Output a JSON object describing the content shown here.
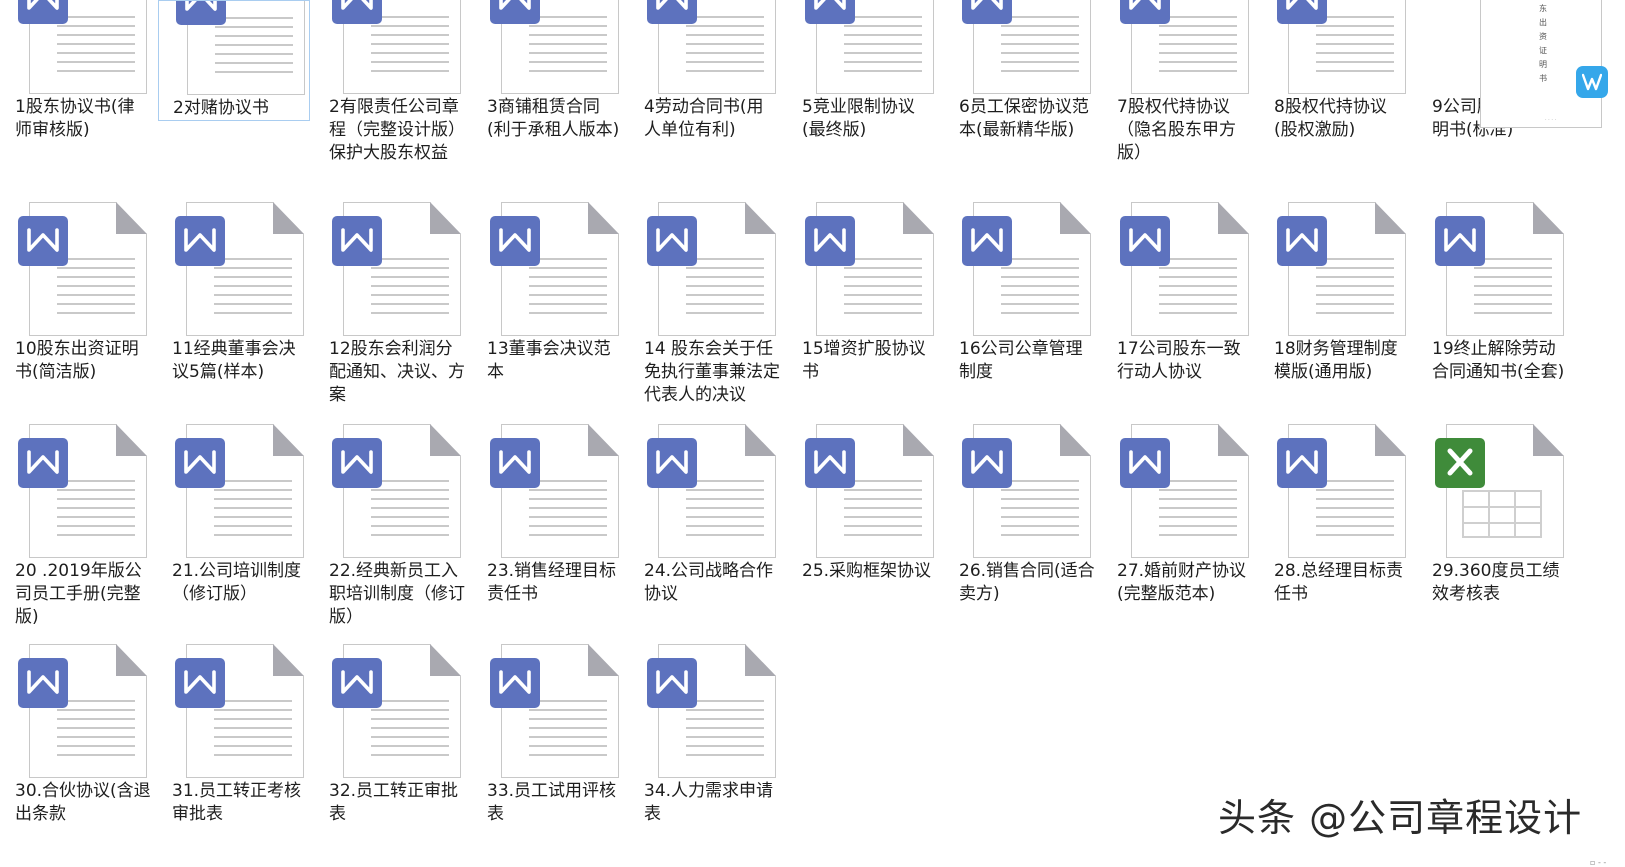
{
  "files": [
    {
      "name": "1股东协议书(律师审核版)",
      "type": "word"
    },
    {
      "name": "2对赌协议书",
      "type": "word",
      "selected": true
    },
    {
      "name": "2有限责任公司章程（完整设计版）保护大股东权益",
      "type": "word"
    },
    {
      "name": "3商铺租赁合同(利于承租人版本)",
      "type": "word"
    },
    {
      "name": "4劳动合同书(用人单位有利)",
      "type": "word"
    },
    {
      "name": "5竞业限制协议(最终版)",
      "type": "word"
    },
    {
      "name": "6员工保密协议范本(最新精华版)",
      "type": "word"
    },
    {
      "name": "7股权代持协议（隐名股东甲方版）",
      "type": "word"
    },
    {
      "name": "8股权代持协议(股权激励)",
      "type": "word"
    },
    {
      "name": "9公司股东出资证明书(标准)",
      "type": "thumbnail"
    },
    {
      "name": "10股东出资证明书(简洁版)",
      "type": "word"
    },
    {
      "name": "11经典董事会决议5篇(样本)",
      "type": "word"
    },
    {
      "name": "12股东会利润分配通知、决议、方案",
      "type": "word"
    },
    {
      "name": "13董事会决议范本",
      "type": "word"
    },
    {
      "name": "14 股东会关于任免执行董事兼法定代表人的决议",
      "type": "word"
    },
    {
      "name": "15增资扩股协议书",
      "type": "word"
    },
    {
      "name": "16公司公章管理制度",
      "type": "word"
    },
    {
      "name": "17公司股东一致行动人协议",
      "type": "word"
    },
    {
      "name": "18财务管理制度模版(通用版)",
      "type": "word"
    },
    {
      "name": "19终止解除劳动合同通知书(全套)",
      "type": "word"
    },
    {
      "name": "20 .2019年版公司员工手册(完整版)",
      "type": "word"
    },
    {
      "name": "21.公司培训制度（修订版）",
      "type": "word"
    },
    {
      "name": "22.经典新员工入职培训制度（修订版）",
      "type": "word"
    },
    {
      "name": "23.销售经理目标责任书",
      "type": "word"
    },
    {
      "name": "24.公司战略合作协议",
      "type": "word"
    },
    {
      "name": "25.采购框架协议",
      "type": "word"
    },
    {
      "name": "26.销售合同(适合卖方)",
      "type": "word"
    },
    {
      "name": "27.婚前财产协议(完整版范本)",
      "type": "word"
    },
    {
      "name": "28.总经理目标责任书",
      "type": "word"
    },
    {
      "name": "29.360度员工绩效考核表",
      "type": "excel"
    },
    {
      "name": "30.合伙协议(含退出条款",
      "type": "word"
    },
    {
      "name": "31.员工转正考核审批表",
      "type": "word"
    },
    {
      "name": "32.员工转正审批表",
      "type": "word"
    },
    {
      "name": "33.员工试用评核表",
      "type": "word"
    },
    {
      "name": "34.人力需求申请表",
      "type": "word"
    }
  ],
  "thumbnail_text": "东出资证明书",
  "watermark": "头条 @公司章程设计",
  "colors": {
    "word_badge": "#5d72be",
    "excel_badge": "#3f8b3a",
    "wps_badge": "#35a7ea",
    "selection_border": "#a9cdf0"
  },
  "icons": {
    "word": "word-document-icon",
    "excel": "excel-document-icon",
    "wps": "wps-logo-icon"
  }
}
